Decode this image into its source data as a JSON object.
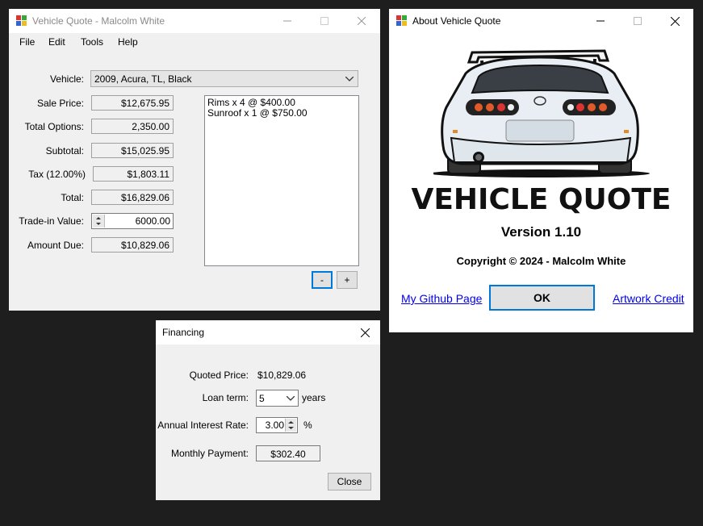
{
  "main_window": {
    "title": "Vehicle Quote - Malcolm White",
    "menu": [
      "File",
      "Edit",
      "Tools",
      "Help"
    ],
    "vehicle_label": "Vehicle:",
    "vehicle_value": "2009, Acura, TL, Black",
    "rows": [
      {
        "label": "Sale Price:",
        "value": "$12,675.95"
      },
      {
        "label": "Total Options:",
        "value": "2,350.00"
      },
      {
        "label": "Subtotal:",
        "value": "$15,025.95"
      },
      {
        "label": "Tax (12.00%)",
        "value": "$1,803.11"
      },
      {
        "label": "Total:",
        "value": "$16,829.06"
      },
      {
        "label": "Trade-in Value:",
        "value": "6000.00"
      },
      {
        "label": "Amount Due:",
        "value": "$10,829.06"
      }
    ],
    "options_list": [
      "Rims x 4 @ $400.00",
      "Sunroof x 1 @ $750.00"
    ],
    "minus_label": "-",
    "plus_label": "+"
  },
  "about_window": {
    "title": "About Vehicle Quote",
    "logo_text": "VEHICLE QUOTE",
    "version": "Version 1.10",
    "copyright": "Copyright © 2024 - Malcolm White",
    "github_link": "My Github Page",
    "ok_label": "OK",
    "artwork_link": "Artwork Credit"
  },
  "financing_window": {
    "title": "Financing",
    "quoted_label": "Quoted Price:",
    "quoted_value": "$10,829.06",
    "loan_term_label": "Loan term:",
    "loan_term_value": "5",
    "loan_term_unit": "years",
    "rate_label": "Annual Interest Rate:",
    "rate_value": "3.00",
    "rate_unit": "%",
    "payment_label": "Monthly Payment:",
    "payment_value": "$302.40",
    "close_label": "Close"
  },
  "colors": {
    "focus_blue": "#0078d7",
    "link": "#0000ee",
    "background": "#1e1e1e"
  }
}
